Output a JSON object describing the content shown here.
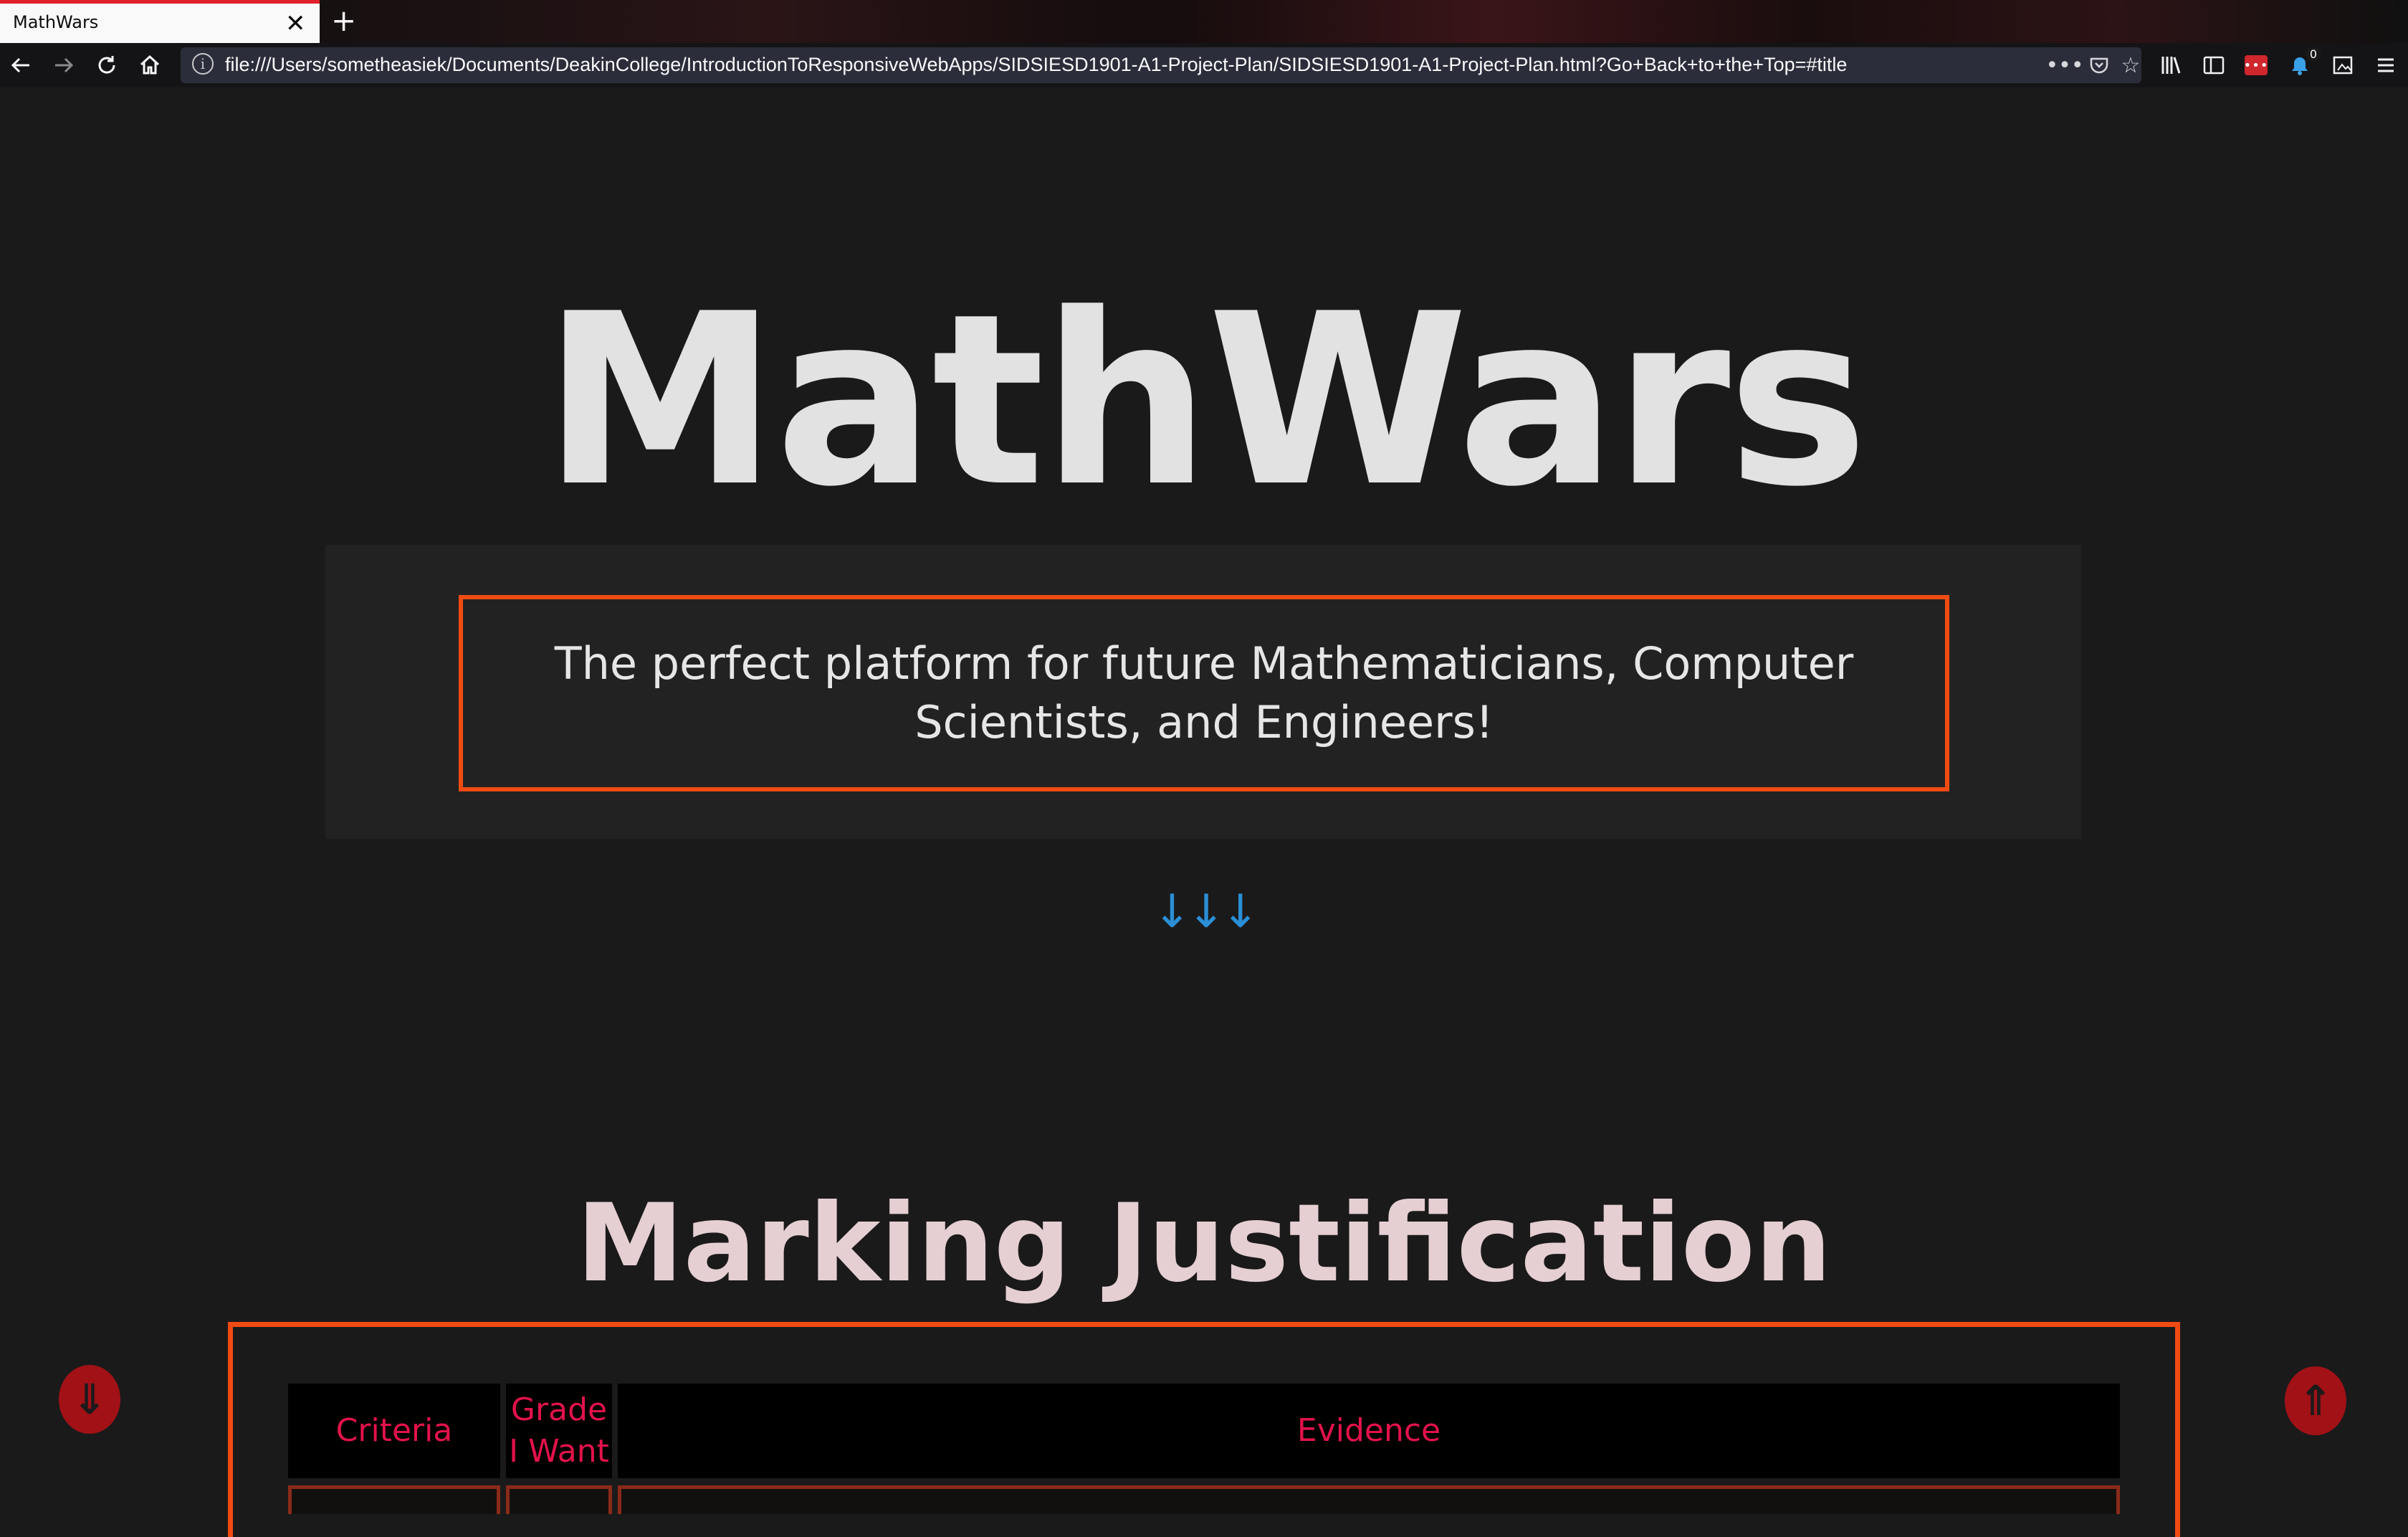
{
  "browser": {
    "tab_title": "MathWars",
    "tab_close_glyph": "✕",
    "new_tab_glyph": "+",
    "url": "file:///Users/sometheasiek/Documents/DeakinCollege/IntroductionToResponsiveWebApps/SIDSIESD1901-A1-Project-Plan/SIDSIESD1901-A1-Project-Plan.html?Go+Back+to+the+Top=#title",
    "notification_badge": "0",
    "icons": {
      "back": "back-arrow-icon",
      "forward": "forward-arrow-icon",
      "reload": "reload-icon",
      "home": "home-icon",
      "info": "info-icon",
      "page_actions": "more-icon",
      "pocket": "pocket-icon",
      "bookmark": "star-icon",
      "library": "library-icon",
      "sidebar": "sidebar-icon",
      "extension": "extension-icon",
      "notifications": "bell-icon",
      "screenshot": "screenshot-icon",
      "menu": "hamburger-menu-icon"
    }
  },
  "page": {
    "title": "MathWars",
    "tagline": "The perfect platform for future Mathematicians, Computer Scientists, and Engineers!",
    "scroll_down_glyph": "↓↓↓",
    "section_heading": "Marking Justification",
    "table": {
      "headers": {
        "criteria": "Criteria",
        "grade": "Grade I Want",
        "evidence": "Evidence"
      }
    },
    "scroll_down_button_glyph": "⇓",
    "scroll_up_button_glyph": "⇑"
  },
  "colors": {
    "background": "#1b1a1b",
    "accent_border": "#f04b12",
    "table_header_text": "#e3124a",
    "arrow_blue": "#2a8fd6",
    "float_button": "#a11116"
  }
}
